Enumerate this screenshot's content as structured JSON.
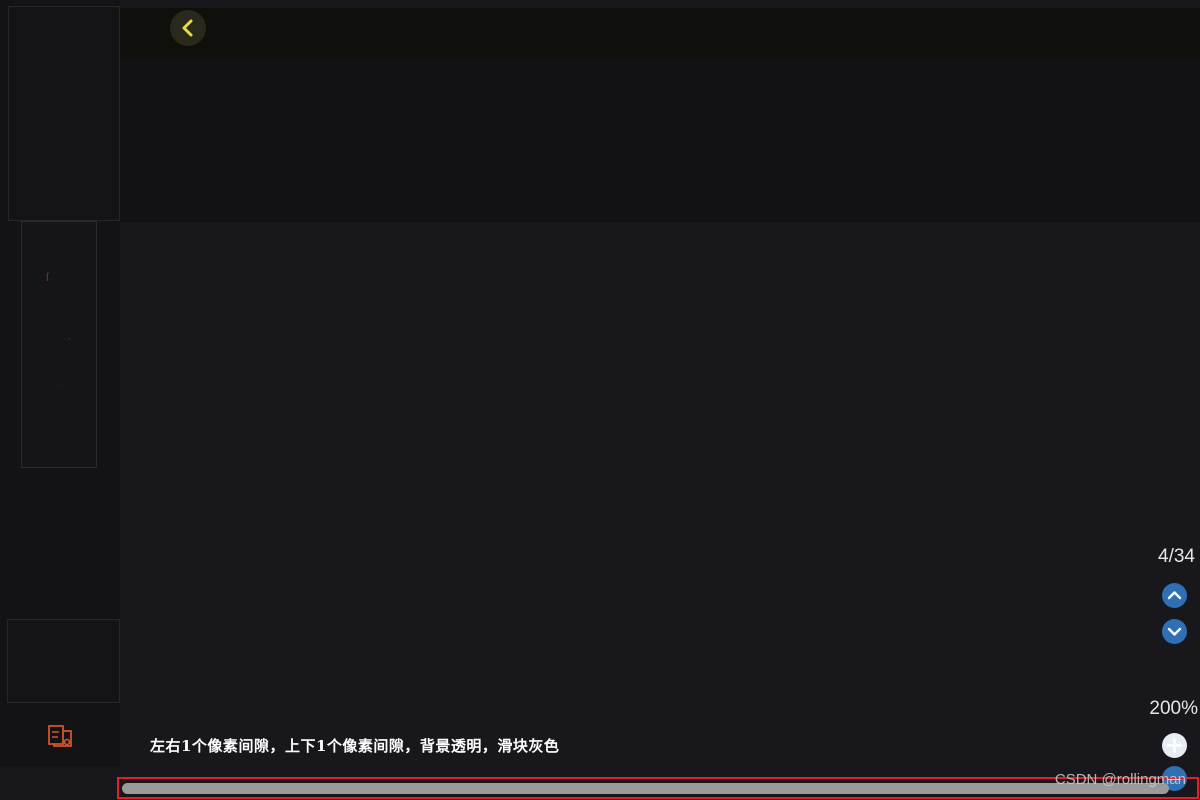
{
  "viewer": {
    "page_indicator": "4/34",
    "zoom_level": "200%"
  },
  "annotation": {
    "text": "左右1个像素间隙，上下1个像素间隙，背景透明，滑块灰色"
  },
  "watermark": {
    "text": "CSDN @rollingman"
  },
  "colors": {
    "accent_blue": "#2f6fb3",
    "back_icon_yellow": "#e8d84a",
    "scrollbar_thumb": "#9a9a9a",
    "highlight_border": "#e0202a"
  },
  "icons": {
    "back": "chevron-left-icon",
    "prev_page": "chevron-up-icon",
    "next_page": "chevron-down-icon",
    "zoom_in": "plus-icon",
    "zoom_out": "minus-icon",
    "tool": "document-tool-icon"
  }
}
